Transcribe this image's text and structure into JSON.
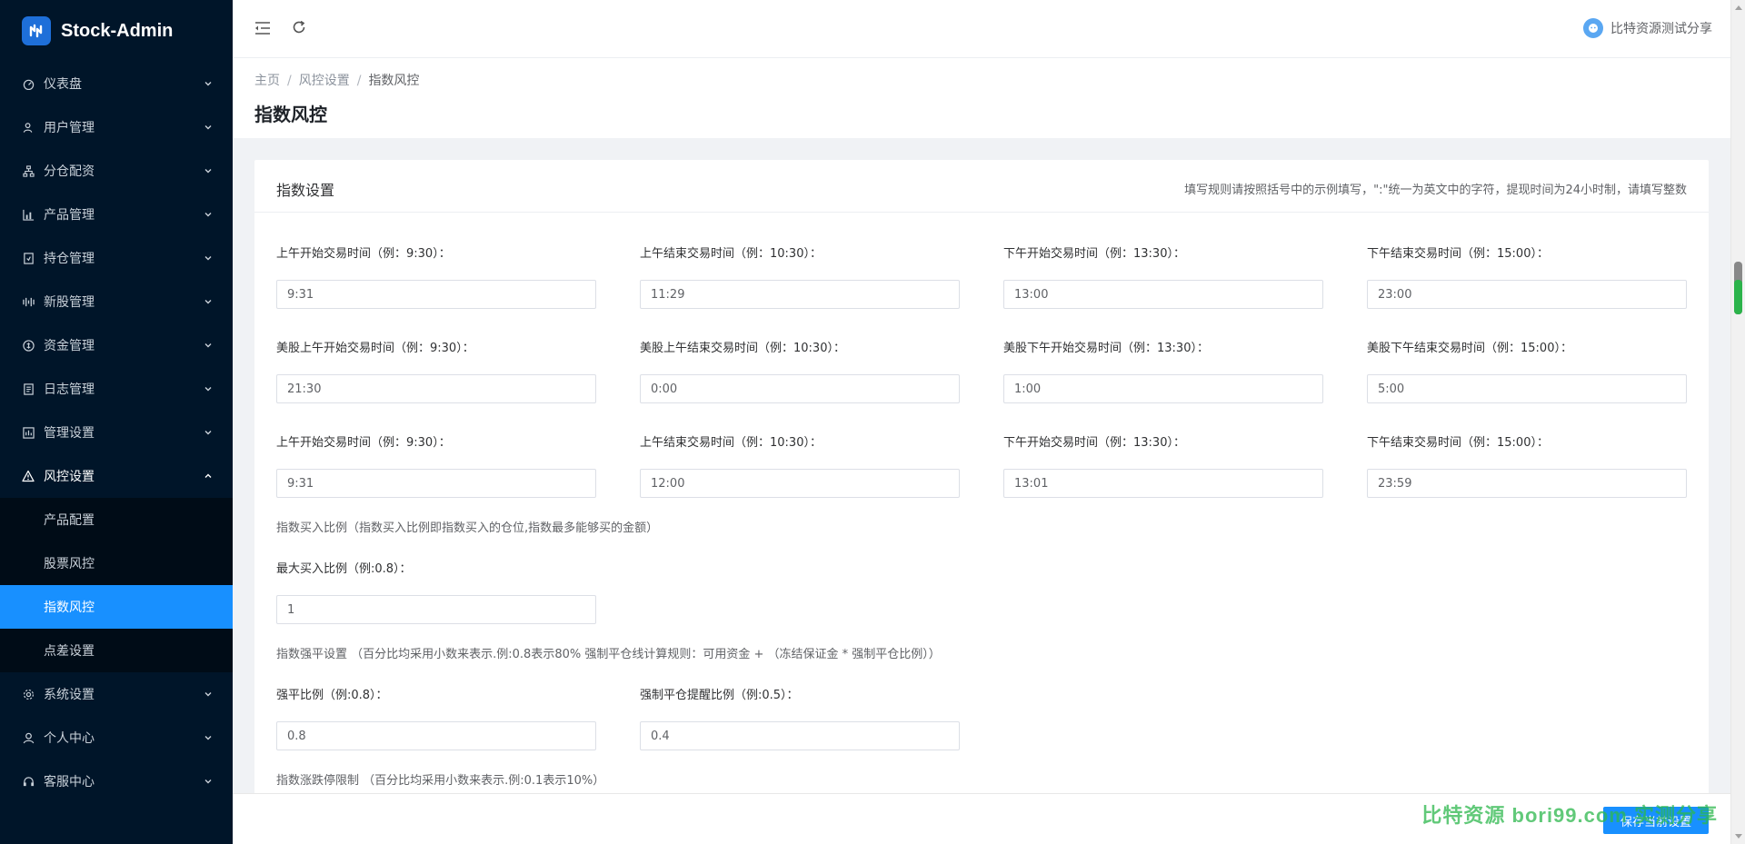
{
  "app": {
    "name": "Stock-Admin"
  },
  "sidebar": {
    "items": [
      {
        "label": "仪表盘",
        "icon": "dashboard-icon"
      },
      {
        "label": "用户管理",
        "icon": "users-icon"
      },
      {
        "label": "分仓配资",
        "icon": "branch-icon"
      },
      {
        "label": "产品管理",
        "icon": "chart-icon"
      },
      {
        "label": "持仓管理",
        "icon": "position-icon"
      },
      {
        "label": "新股管理",
        "icon": "ipo-icon"
      },
      {
        "label": "资金管理",
        "icon": "money-icon"
      },
      {
        "label": "日志管理",
        "icon": "log-icon"
      },
      {
        "label": "管理设置",
        "icon": "settings-panel-icon"
      },
      {
        "label": "风控设置",
        "icon": "warning-icon"
      }
    ],
    "risk_submenu": [
      {
        "label": "产品配置"
      },
      {
        "label": "股票风控"
      },
      {
        "label": "指数风控"
      },
      {
        "label": "点差设置"
      }
    ],
    "bottom_items": [
      {
        "label": "系统设置",
        "icon": "gear-icon"
      },
      {
        "label": "个人中心",
        "icon": "user-icon"
      },
      {
        "label": "客服中心",
        "icon": "headset-icon"
      }
    ]
  },
  "header": {
    "username": "比特资源测试分享"
  },
  "breadcrumb": {
    "home": "主页",
    "parent": "风控设置",
    "current": "指数风控",
    "sep": "/"
  },
  "page": {
    "title": "指数风控"
  },
  "card": {
    "title": "指数设置",
    "hint": "填写规则请按照括号中的示例填写，\":\"统一为英文中的字符，提现时间为24小时制，请填写整数"
  },
  "rows": {
    "r1": [
      {
        "label": "上午开始交易时间（例：9:30）：",
        "value": "9:31"
      },
      {
        "label": "上午结束交易时间（例：10:30）：",
        "value": "11:29"
      },
      {
        "label": "下午开始交易时间（例：13:30）：",
        "value": "13:00"
      },
      {
        "label": "下午结束交易时间（例：15:00）：",
        "value": "23:00"
      }
    ],
    "r2": [
      {
        "label": "美股上午开始交易时间（例：9:30）：",
        "value": "21:30"
      },
      {
        "label": "美股上午结束交易时间（例：10:30）：",
        "value": "0:00"
      },
      {
        "label": "美股下午开始交易时间（例：13:30）：",
        "value": "1:00"
      },
      {
        "label": "美股下午结束交易时间（例：15:00）：",
        "value": "5:00"
      }
    ],
    "r3": [
      {
        "label": "上午开始交易时间（例：9:30）：",
        "value": "9:31"
      },
      {
        "label": "上午结束交易时间（例：10:30）：",
        "value": "12:00"
      },
      {
        "label": "下午开始交易时间（例：13:30）：",
        "value": "13:01"
      },
      {
        "label": "下午结束交易时间（例：15:00）：",
        "value": "23:59"
      }
    ]
  },
  "buy_ratio": {
    "note": "指数买入比例（指数买入比例即指数买入的仓位,指数最多能够买的金额）",
    "label": "最大买入比例（例:0.8）：",
    "value": "1"
  },
  "liquidation": {
    "note": "指数强平设置 （百分比均采用小数来表示.例:0.8表示80% 强制平仓线计算规则：可用资金 + （冻结保证金 * 强制平仓比例））",
    "fields": [
      {
        "label": "强平比例（例:0.8）：",
        "value": "0.8"
      },
      {
        "label": "强制平仓提醒比例（例:0.5）：",
        "value": "0.4"
      }
    ]
  },
  "limit": {
    "note": "指数涨跌停限制 （百分比均采用小数来表示.例:0.1表示10%）"
  },
  "footer": {
    "save_label": "保存当前设置",
    "watermark": "比特资源 bori99.com 实测分享"
  },
  "colors": {
    "sidebar_bg": "#001529",
    "submenu_bg": "#000c17",
    "accent": "#1890ff",
    "watermark": "#2db84d"
  }
}
